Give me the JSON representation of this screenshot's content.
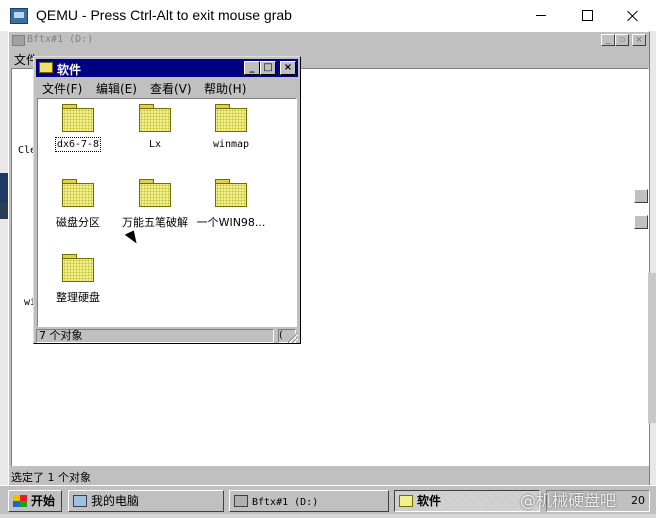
{
  "host": {
    "title": "QEMU - Press Ctrl-Alt to exit mouse grab"
  },
  "bg_window": {
    "title": "Bftx#1 (D:)",
    "menu_file": "文件",
    "status": "选定了 1 个对象",
    "partial_1": "Cle",
    "partial_2": "wi"
  },
  "window": {
    "title": "软件",
    "menu": [
      "文件(F)",
      "编辑(E)",
      "查看(V)",
      "帮助(H)"
    ],
    "status": "7 个对象",
    "status_right": "("
  },
  "items": [
    {
      "label": "dx6-7-8"
    },
    {
      "label": "Lx"
    },
    {
      "label": "winmap"
    },
    {
      "label": "磁盘分区"
    },
    {
      "label": "万能五笔破解"
    },
    {
      "label": "一个WIN98..."
    },
    {
      "label": "整理硬盘"
    }
  ],
  "taskbar": {
    "start": "开始",
    "tasks": [
      "我的电脑",
      "Bftx#1 (D:)",
      "软件"
    ],
    "clock": "20"
  },
  "watermark": "@机械硬盘吧",
  "colors": {
    "active_title": "#000080",
    "window_face": "#c0c0c0",
    "folder": "#f1f089"
  }
}
